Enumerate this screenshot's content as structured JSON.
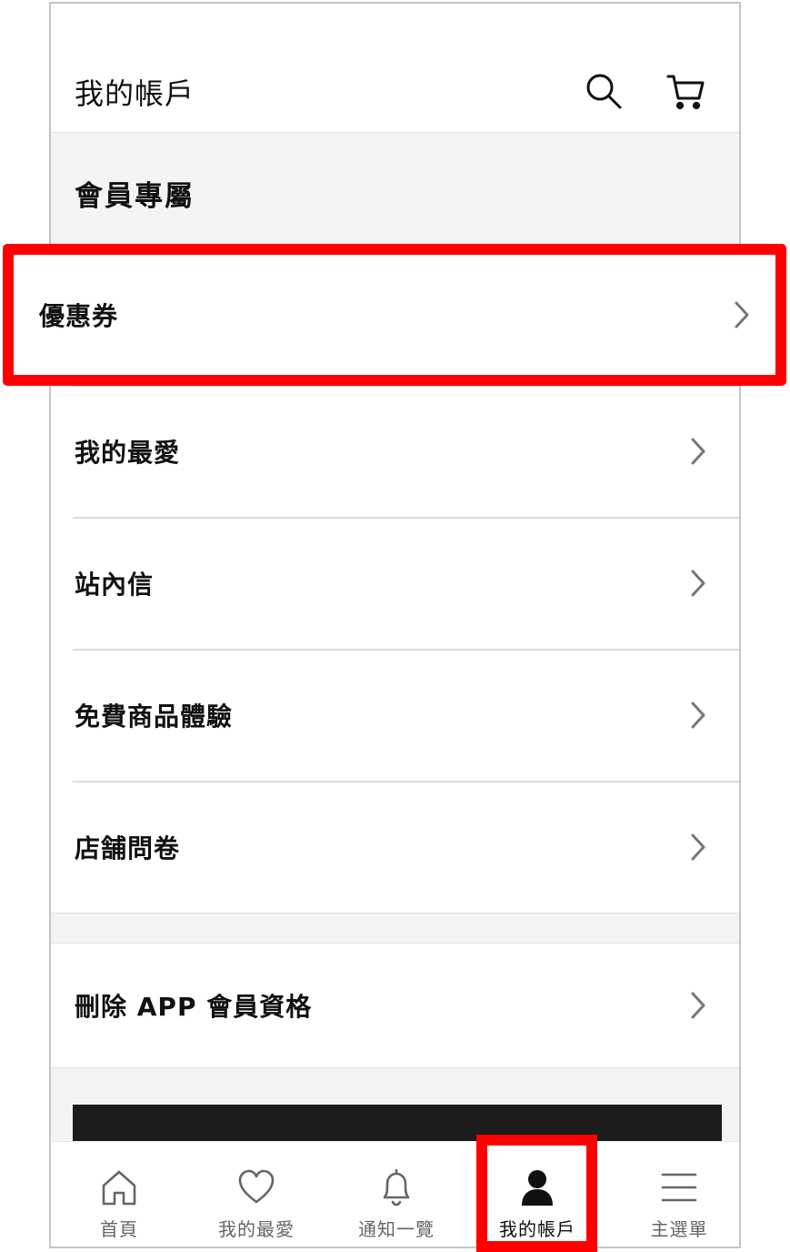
{
  "header": {
    "title": "我的帳戶",
    "search_icon": "search-icon",
    "cart_icon": "cart-icon"
  },
  "section": {
    "title": "會員專屬"
  },
  "menu": {
    "items": [
      {
        "label": "優惠券"
      },
      {
        "label": "我的最愛"
      },
      {
        "label": "站內信"
      },
      {
        "label": "免費商品體驗"
      },
      {
        "label": "店舗問卷"
      }
    ],
    "delete_membership": "刪除 APP 會員資格"
  },
  "bottom_nav": {
    "items": [
      {
        "label": "首頁",
        "icon": "home-icon"
      },
      {
        "label": "我的最愛",
        "icon": "heart-icon"
      },
      {
        "label": "通知一覽",
        "icon": "bell-icon"
      },
      {
        "label": "我的帳戶",
        "icon": "user-icon",
        "active": true
      },
      {
        "label": "主選單",
        "icon": "menu-icon"
      }
    ]
  },
  "colors": {
    "highlight": "#ff0000",
    "text": "#111111",
    "nav_inactive": "#666666",
    "section_bg": "#f4f4f4",
    "banner": "#1c1c1c"
  }
}
